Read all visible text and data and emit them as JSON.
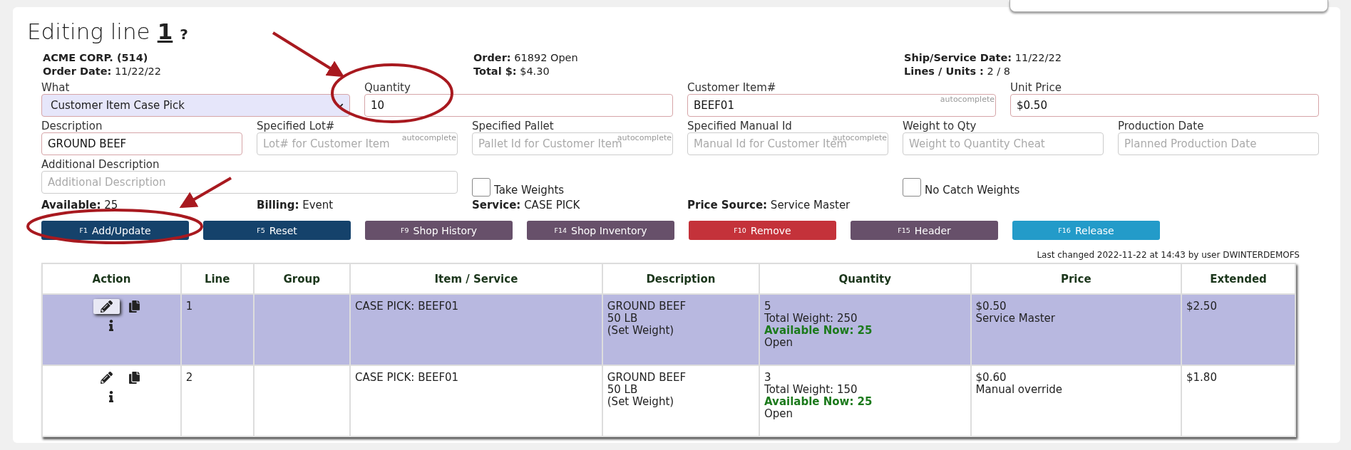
{
  "title": {
    "text": "Editing line",
    "line": "1",
    "help": "?"
  },
  "header_columns": [
    [
      {
        "label": "ACME CORP. (514)"
      },
      {
        "label": "Order Date:",
        "value": "11/22/22"
      }
    ],
    [
      {
        "label": "Order:",
        "value": "61892 Open"
      },
      {
        "label": "Total $:",
        "value": "$4.30"
      }
    ],
    [
      {
        "label": "Ship/Service Date:",
        "value": "11/22/22"
      },
      {
        "label": "Lines / Units :",
        "value": "2 / 8"
      }
    ]
  ],
  "fields_row_1": [
    {
      "kind": "select",
      "label": "What",
      "value": "Customer Item Case Pick"
    },
    {
      "kind": "text",
      "label": "Quantity",
      "value": "10"
    },
    {
      "kind": "text",
      "label": "Customer Item#",
      "value": "BEEF01",
      "hint": "autocomplete"
    },
    {
      "kind": "text",
      "label": "Unit Price",
      "value": "$0.50"
    }
  ],
  "fields_row_2": [
    {
      "kind": "text",
      "label": "Description",
      "value": "GROUND BEEF"
    },
    {
      "kind": "text",
      "label": "Specified Lot#",
      "placeholder": "Lot# for Customer Item",
      "hint": "autocomplete"
    },
    {
      "kind": "text",
      "label": "Specified Pallet",
      "placeholder": "Pallet Id for Customer Item",
      "hint": "autocomplete"
    },
    {
      "kind": "text",
      "label": "Specified Manual Id",
      "placeholder": "Manual Id for Customer Item",
      "hint": "autocomplete"
    },
    {
      "kind": "text",
      "label": "Weight to Qty",
      "placeholder": "Weight to Quantity Cheat"
    },
    {
      "kind": "text",
      "label": "Production Date",
      "placeholder": "Planned Production Date"
    }
  ],
  "additional_description": {
    "label": "Additional Description",
    "placeholder": "Additional Description"
  },
  "checkboxes": [
    {
      "label": "Take Weights",
      "checked": false
    },
    {
      "label": "No Catch Weights",
      "checked": false
    }
  ],
  "info": [
    {
      "label": "Available:",
      "value": "25"
    },
    {
      "label": "Billing:",
      "value": "Event"
    },
    {
      "label": "Service:",
      "value": "CASE PICK"
    },
    {
      "label": "Price Source:",
      "value": "Service Master"
    }
  ],
  "buttons": [
    {
      "key": "F1",
      "label": "Add/Update",
      "color": "#15426b"
    },
    {
      "key": "F5",
      "label": "Reset",
      "color": "#15426b"
    },
    {
      "key": "F9",
      "label": "Shop History",
      "color": "#67506a"
    },
    {
      "key": "F14",
      "label": "Shop Inventory",
      "color": "#67506a"
    },
    {
      "key": "F10",
      "label": "Remove",
      "color": "#c4323a"
    },
    {
      "key": "F15",
      "label": "Header",
      "color": "#67506a"
    },
    {
      "key": "F16",
      "label": "Release",
      "color": "#239bc9"
    }
  ],
  "last_changed": "Last changed 2022-11-22 at 14:43 by user DWINTERDEMOFS",
  "table": {
    "columns": [
      "Action",
      "Line",
      "Group",
      "Item / Service",
      "Description",
      "Quantity",
      "Price",
      "Extended"
    ],
    "rows": [
      {
        "selected": true,
        "line": "1",
        "item": "CASE PICK: BEEF01",
        "description": [
          "GROUND BEEF",
          "50 LB",
          "(Set Weight)"
        ],
        "quantity": "5",
        "total_weight": "Total Weight: 250",
        "available": "Available Now: 25",
        "status": "Open",
        "price": "$0.50",
        "price_source": "Service Master",
        "extended": "$2.50"
      },
      {
        "selected": false,
        "line": "2",
        "item": "CASE PICK: BEEF01",
        "description": [
          "GROUND BEEF",
          "50 LB",
          "(Set Weight)"
        ],
        "quantity": "3",
        "total_weight": "Total Weight: 150",
        "available": "Available Now: 25",
        "status": "Open",
        "price": "$0.60",
        "price_source": "Manual override",
        "extended": "$1.80"
      }
    ]
  }
}
